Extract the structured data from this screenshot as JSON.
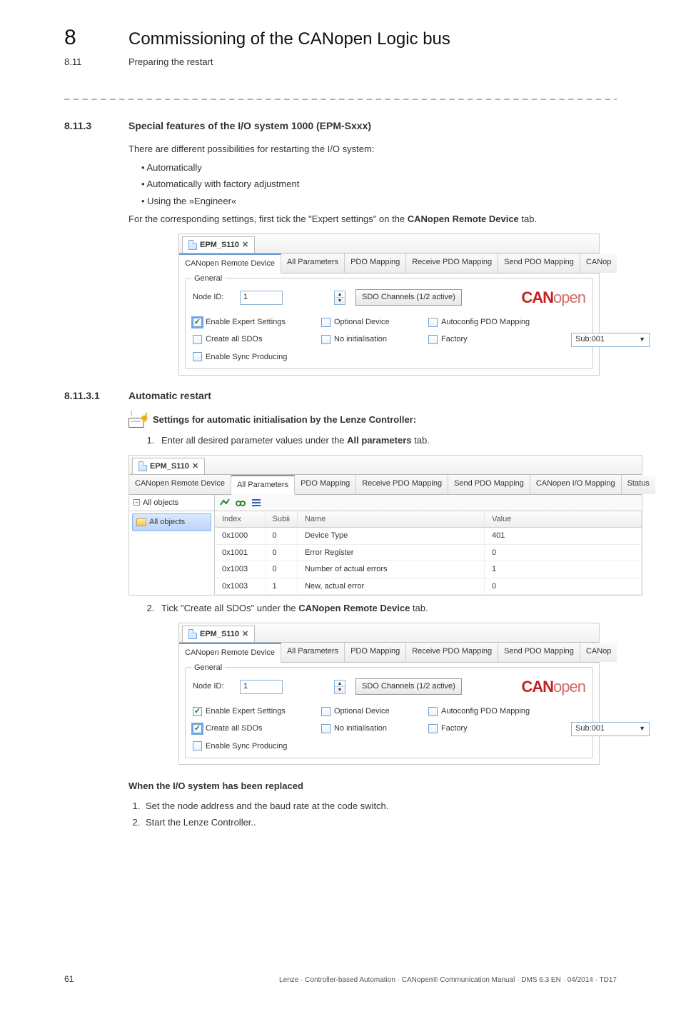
{
  "chapter": {
    "num": "8",
    "title": "Commissioning of the CANopen Logic bus"
  },
  "section": {
    "num": "8.11",
    "title": "Preparing the restart"
  },
  "dashes": "_ _ _ _ _ _ _ _ _ _ _ _ _ _ _ _ _ _ _ _ _ _ _ _ _ _ _ _ _ _ _ _ _ _ _ _ _ _ _ _ _ _ _ _ _ _ _ _ _ _ _ _ _ _ _ _ _ _ _ _ _ _ _ _",
  "h1": {
    "num": "8.11.3",
    "text": "Special features of the I/O system 1000 (EPM-Sxxx)"
  },
  "intro": "There are different possibilities for restarting the I/O system:",
  "bullets": [
    "Automatically",
    "Automatically with factory adjustment",
    "Using the »Engineer«"
  ],
  "intro2_a": "For the corresponding settings, first tick the \"Expert settings\" on the ",
  "intro2_b": "CANopen Remote Device",
  "intro2_c": " tab.",
  "shot1": {
    "filetab": "EPM_S110",
    "close": "✕",
    "tabs": [
      "CANopen Remote Device",
      "All Parameters",
      "PDO Mapping",
      "Receive PDO Mapping",
      "Send PDO Mapping",
      "CANop"
    ],
    "group": "General",
    "node_lbl": "Node ID:",
    "node_val": "1",
    "spin_up": "▲",
    "spin_dn": "▼",
    "sdo_btn": "SDO Channels (1/2 active)",
    "logo_bold": "CAN",
    "logo_light": "open",
    "cb_expert": "Enable Expert Settings",
    "cb_optdev": "Optional Device",
    "cb_autopdo": "Autoconfig PDO Mapping",
    "cb_createsdo": "Create all SDOs",
    "cb_noinit": "No initialisation",
    "cb_factory": "Factory",
    "sub_val": "Sub:001",
    "cb_sync": "Enable Sync Producing"
  },
  "h2": {
    "num": "8.11.3.1",
    "text": "Automatic restart"
  },
  "guide": "Settings for automatic initialisation by the Lenze Controller:",
  "step1_a": "Enter all desired parameter values under the ",
  "step1_b": "All parameters",
  "step1_c": " tab.",
  "shot2": {
    "filetab": "EPM_S110",
    "tabs": [
      "CANopen Remote Device",
      "All Parameters",
      "PDO Mapping",
      "Receive PDO Mapping",
      "Send PDO Mapping",
      "CANopen I/O Mapping",
      "Status"
    ],
    "tree_root": "All objects",
    "tree_sel": "All objects",
    "headers": [
      "Index",
      "Subii",
      "Name",
      "Value"
    ],
    "rows": [
      {
        "idx": "0x1000",
        "sub": "0",
        "name": "Device Type",
        "val": "401"
      },
      {
        "idx": "0x1001",
        "sub": "0",
        "name": "Error Register",
        "val": "0"
      },
      {
        "idx": "0x1003",
        "sub": "0",
        "name": "Number of actual errors",
        "val": "1"
      },
      {
        "idx": "0x1003",
        "sub": "1",
        "name": "New, actual error",
        "val": "0"
      }
    ]
  },
  "step2_a": "Tick \"Create all SDOs\" under the ",
  "step2_b": "CANopen Remote Device",
  "step2_c": " tab.",
  "replaced_heading": "When the I/O system has been replaced",
  "replaced_steps": [
    "Set the node address and the baud rate at the code switch.",
    "Start the Lenze Controller.."
  ],
  "footer": {
    "page": "61",
    "text": "Lenze · Controller-based Automation · CANopen® Communication Manual · DMS 6.3 EN · 04/2014 · TD17"
  }
}
